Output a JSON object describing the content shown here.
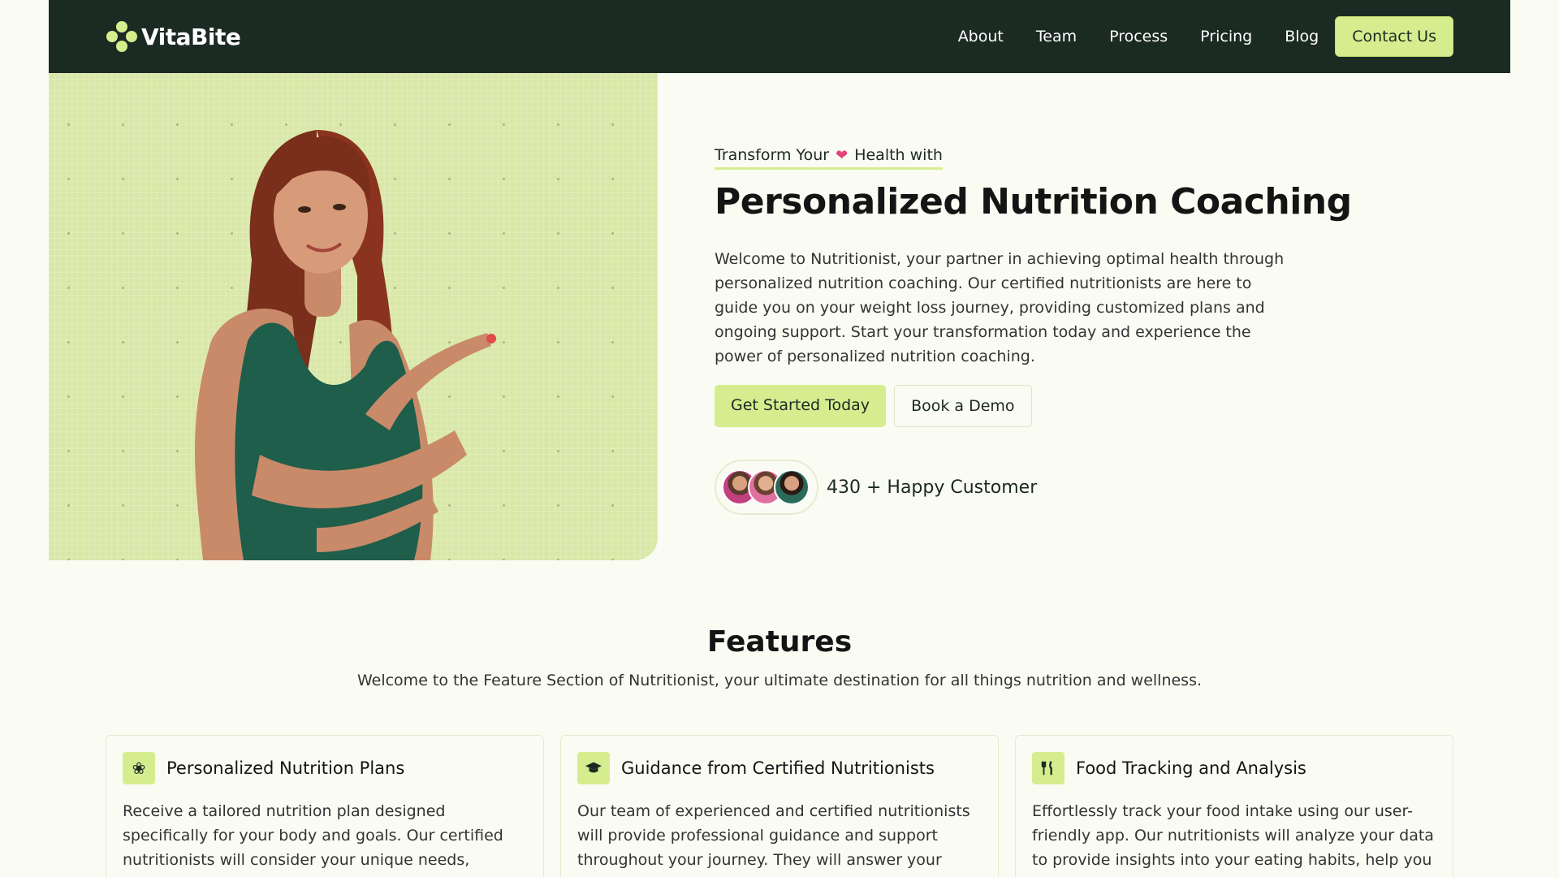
{
  "brand": {
    "name": "VitaBite",
    "logo_icon": "clover-icon"
  },
  "nav": {
    "items": [
      {
        "label": "About"
      },
      {
        "label": "Team"
      },
      {
        "label": "Process"
      },
      {
        "label": "Pricing"
      },
      {
        "label": "Blog"
      }
    ],
    "cta_label": "Contact Us"
  },
  "hero": {
    "eyebrow_before": "Transform Your",
    "eyebrow_after": "Health with",
    "eyebrow_icon": "heart-icon",
    "title": "Personalized Nutrition Coaching",
    "description": "Welcome to Nutritionist, your partner in achieving optimal health through personalized nutrition coaching. Our certified nutritionists are here to guide you on your weight loss journey, providing customized plans and ongoing support. Start your transformation today and experience the power of personalized nutrition coaching.",
    "primary_cta": "Get Started Today",
    "secondary_cta": "Book a Demo",
    "happy_customers": "430 + Happy Customer"
  },
  "features": {
    "title": "Features",
    "subtitle": "Welcome to the Feature Section of Nutritionist, your ultimate destination for all things nutrition and wellness.",
    "cards": [
      {
        "icon": "sprout-icon",
        "title": "Personalized Nutrition Plans",
        "body": "Receive a tailored nutrition plan designed specifically for your body and goals. Our certified nutritionists will consider your unique needs, dietary preferences, and"
      },
      {
        "icon": "graduation-cap-icon",
        "title": "Guidance from Certified Nutritionists",
        "body": "Our team of experienced and certified nutritionists will provide professional guidance and support throughout your journey. They will answer your questions, address"
      },
      {
        "icon": "fork-knife-icon",
        "title": "Food Tracking and Analysis",
        "body": "Effortlessly track your food intake using our user-friendly app. Our nutritionists will analyze your data to provide insights into your eating habits, help you identify areas"
      }
    ]
  },
  "colors": {
    "nav_bg": "#1b2a22",
    "accent": "#d6ed8f",
    "page_bg": "#fafbf3",
    "hero_image_bg": "#d9e8a8"
  }
}
